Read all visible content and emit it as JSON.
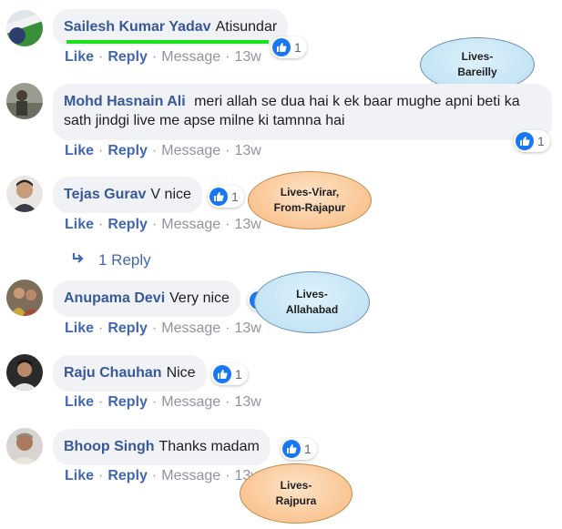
{
  "comments": [
    {
      "name": "Sailesh Kumar Yadav",
      "text": "Atisundar",
      "likes": "1",
      "actions": {
        "like": "Like",
        "reply": "Reply",
        "message": "Message",
        "time": "13w"
      }
    },
    {
      "name": "Mohd Hasnain Ali",
      "text": "meri allah se dua hai k ek baar mughe apni beti ka sath jindgi live me apse milne ki tamnna hai",
      "likes": "1",
      "actions": {
        "like": "Like",
        "reply": "Reply",
        "message": "Message",
        "time": "13w"
      }
    },
    {
      "name": "Tejas Gurav",
      "text": "V nice",
      "likes": "1",
      "actions": {
        "like": "Like",
        "reply": "Reply",
        "message": "Message",
        "time": "13w"
      }
    },
    {
      "name": "Anupama Devi",
      "text": "Very nice",
      "likes": "",
      "actions": {
        "like": "Like",
        "reply": "Reply",
        "message": "Message",
        "time": "13w"
      }
    },
    {
      "name": "Raju Chauhan",
      "text": "Nice",
      "likes": "1",
      "actions": {
        "like": "Like",
        "reply": "Reply",
        "message": "Message",
        "time": "13w"
      }
    },
    {
      "name": "Bhoop Singh",
      "text": "Thanks madam",
      "likes": "1",
      "actions": {
        "like": "Like",
        "reply": "Reply",
        "message": "Message",
        "time": "13w"
      }
    }
  ],
  "replies_link": "1 Reply",
  "annotations": {
    "bareilly": [
      "Lives-",
      "Bareilly"
    ],
    "virar": [
      "Lives-Virar,",
      "From-Rajapur"
    ],
    "allahabad": [
      "Lives-",
      "Allahabad"
    ],
    "rajpura": [
      "Lives-",
      "Rajpura"
    ]
  },
  "colors": {
    "name": "#385898",
    "link": "#4267b2",
    "bubble": "#f0f2f5",
    "like": "#1877f2",
    "highlight": "#19e21a"
  }
}
